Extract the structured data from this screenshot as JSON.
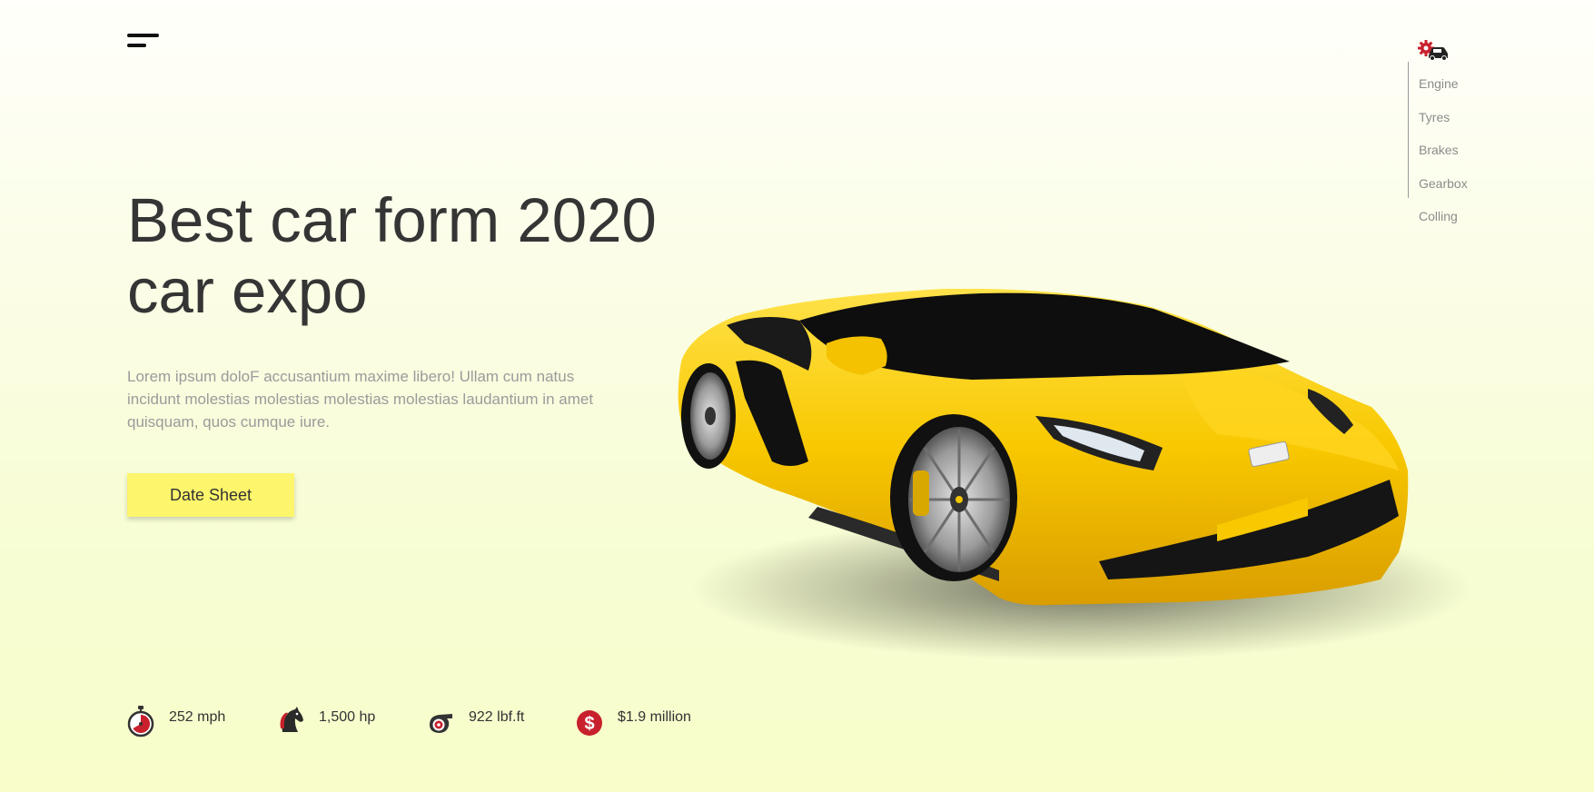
{
  "nav": {
    "menu_icon": "hamburger-icon",
    "side_icon": "car-gear-icon",
    "items": [
      {
        "label": "Engine"
      },
      {
        "label": "Tyres"
      },
      {
        "label": "Brakes"
      },
      {
        "label": "Gearbox"
      },
      {
        "label": "Colling"
      }
    ]
  },
  "hero": {
    "title_line1": "Best car form 2020",
    "title_line2": "car expo",
    "description": "Lorem ipsum doloF accusantium maxime libero! Ullam cum natus incidunt molestias molestias molestias molestias laudantium in amet quisquam, quos cumque iure.",
    "cta_label": "Date Sheet"
  },
  "stats": [
    {
      "icon": "stopwatch-icon",
      "value": "252 mph"
    },
    {
      "icon": "horse-icon",
      "value": "1,500 hp"
    },
    {
      "icon": "turbo-icon",
      "value": "922 lbf.ft"
    },
    {
      "icon": "dollar-icon",
      "value": "$1.9 million"
    }
  ],
  "colors": {
    "accent": "#fdf56b",
    "icon_red": "#c8202c",
    "car_yellow": "#f6c500",
    "text_dark": "#353535",
    "text_muted": "#9b9b9b"
  },
  "image": {
    "subject": "yellow-sports-car"
  }
}
